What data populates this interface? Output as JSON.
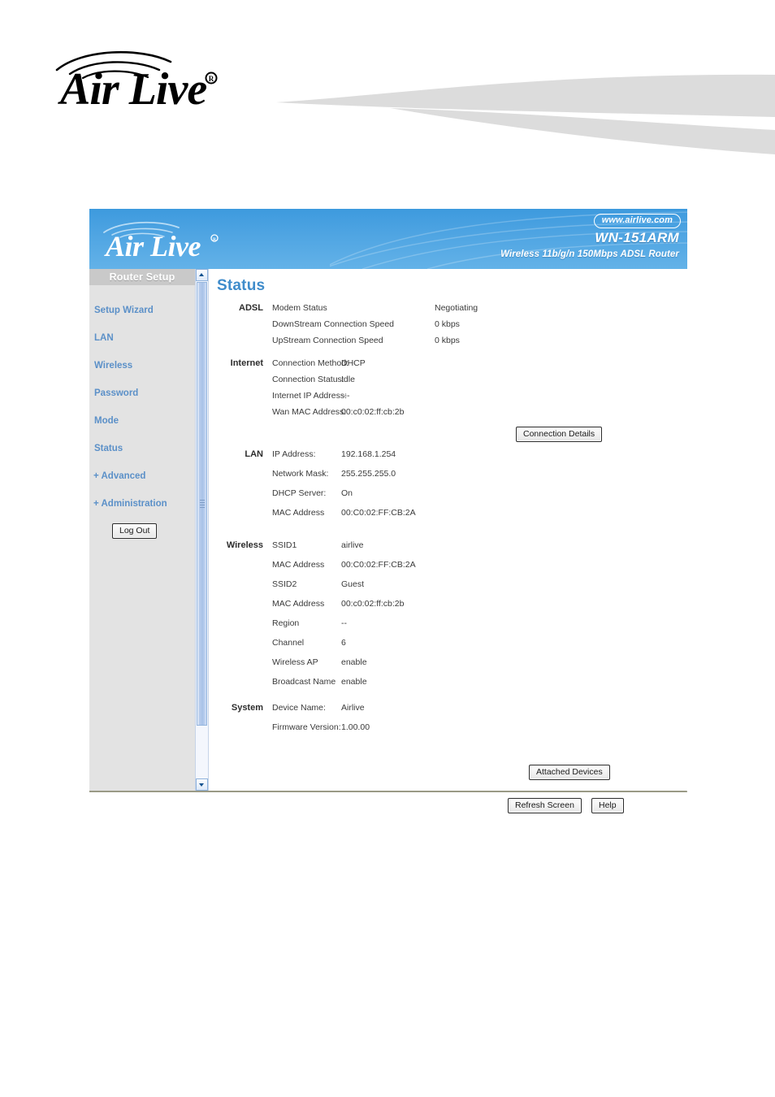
{
  "brand": {
    "name": "Air Live",
    "registered_mark": "®",
    "wifi_arc_icon": "wifi-arcs-icon"
  },
  "banner": {
    "site_badge": "www.airlive.com",
    "model": "WN-151ARM",
    "description": "Wireless 11b/g/n 150Mbps ADSL Router"
  },
  "sidebar": {
    "title": "Router Setup",
    "items": [
      {
        "label": "Setup Wizard"
      },
      {
        "label": "LAN"
      },
      {
        "label": "Wireless"
      },
      {
        "label": "Password"
      },
      {
        "label": "Mode"
      },
      {
        "label": "Status"
      },
      {
        "label": "+ Advanced"
      },
      {
        "label": "+ Administration"
      }
    ],
    "logout_label": "Log Out"
  },
  "scrollbar": {
    "up_icon": "chevron-up-icon",
    "down_icon": "chevron-down-icon"
  },
  "page": {
    "heading": "Status"
  },
  "sections": {
    "adsl": {
      "label": "ADSL",
      "rows": [
        {
          "key": "Modem Status",
          "value": "Negotiating"
        },
        {
          "key": "DownStream Connection Speed",
          "value": "0 kbps"
        },
        {
          "key": "UpStream Connection Speed",
          "value": "0 kbps"
        }
      ]
    },
    "internet": {
      "label": "Internet",
      "rows": [
        {
          "key": "Connection Method:",
          "value": "DHCP"
        },
        {
          "key": "Connection Status:",
          "value": "Idle"
        },
        {
          "key": "Internet IP Address:",
          "value": "---"
        },
        {
          "key": "Wan MAC Address:",
          "value": "00:c0:02:ff:cb:2b"
        }
      ],
      "details_button": "Connection Details"
    },
    "lan": {
      "label": "LAN",
      "rows": [
        {
          "key": "IP Address:",
          "value": "192.168.1.254"
        },
        {
          "key": "Network Mask:",
          "value": "255.255.255.0"
        },
        {
          "key": "DHCP Server:",
          "value": "On"
        },
        {
          "key": "MAC Address",
          "value": "00:C0:02:FF:CB:2A"
        }
      ]
    },
    "wireless": {
      "label": "Wireless",
      "rows": [
        {
          "key": "SSID1",
          "value": "airlive"
        },
        {
          "key": "MAC Address",
          "value": "00:C0:02:FF:CB:2A"
        },
        {
          "key": "SSID2",
          "value": "Guest"
        },
        {
          "key": "MAC Address",
          "value": "00:c0:02:ff:cb:2b"
        },
        {
          "key": "Region",
          "value": "--"
        },
        {
          "key": "Channel",
          "value": "6"
        },
        {
          "key": "Wireless AP",
          "value": "enable"
        },
        {
          "key": "Broadcast Name",
          "value": "enable"
        }
      ]
    },
    "system": {
      "label": "System",
      "rows": [
        {
          "key": "Device Name:",
          "value": "Airlive"
        },
        {
          "key": "Firmware Version:",
          "value": "1.00.00"
        }
      ]
    }
  },
  "buttons": {
    "attached_devices": "Attached Devices",
    "refresh_screen": "Refresh Screen",
    "help": "Help"
  },
  "colors": {
    "banner_blue": "#4ea4e2",
    "heading_blue": "#3f8ccb",
    "nav_blue": "#5b90c8",
    "sidebar_bg": "#e3e3e3",
    "sidebar_title_bg": "#c9c9c9",
    "swoosh_gray": "#dcdcdc"
  }
}
